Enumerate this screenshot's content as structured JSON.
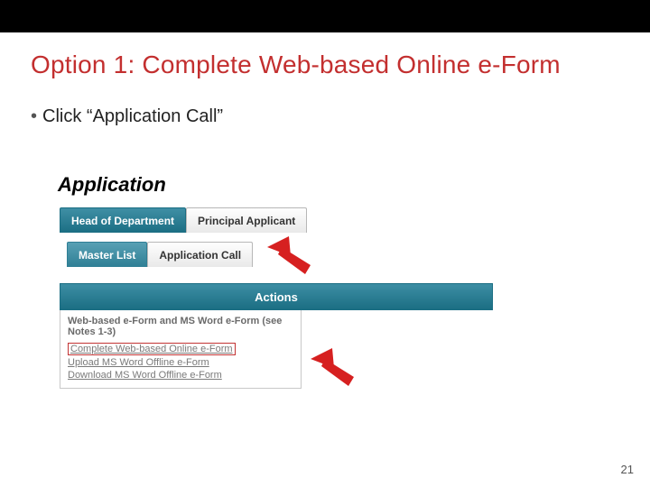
{
  "title": "Option 1: Complete Web-based Online e-Form",
  "bullet": "Click “Application Call”",
  "screenshot": {
    "heading": "Application",
    "top_tabs": [
      {
        "label": "Head of Department",
        "variant": "active-teal"
      },
      {
        "label": "Principal Applicant",
        "variant": ""
      }
    ],
    "sub_tabs": [
      {
        "label": "Master List",
        "variant": "sub-active"
      },
      {
        "label": "Application Call",
        "variant": ""
      }
    ],
    "actions_header": "Actions",
    "actions_section": "Web-based e-Form and MS Word e-Form (see Notes 1-3)",
    "actions_links": [
      {
        "label": "Complete Web-based Online e-Form",
        "boxed": true
      },
      {
        "label": "Upload MS Word Offline e-Form",
        "boxed": false
      },
      {
        "label": "Download MS Word Offline e-Form",
        "boxed": false
      }
    ]
  },
  "page_number": "21",
  "colors": {
    "title": "#c32f2f",
    "teal": "#1b6e83",
    "arrow": "#d62020"
  }
}
